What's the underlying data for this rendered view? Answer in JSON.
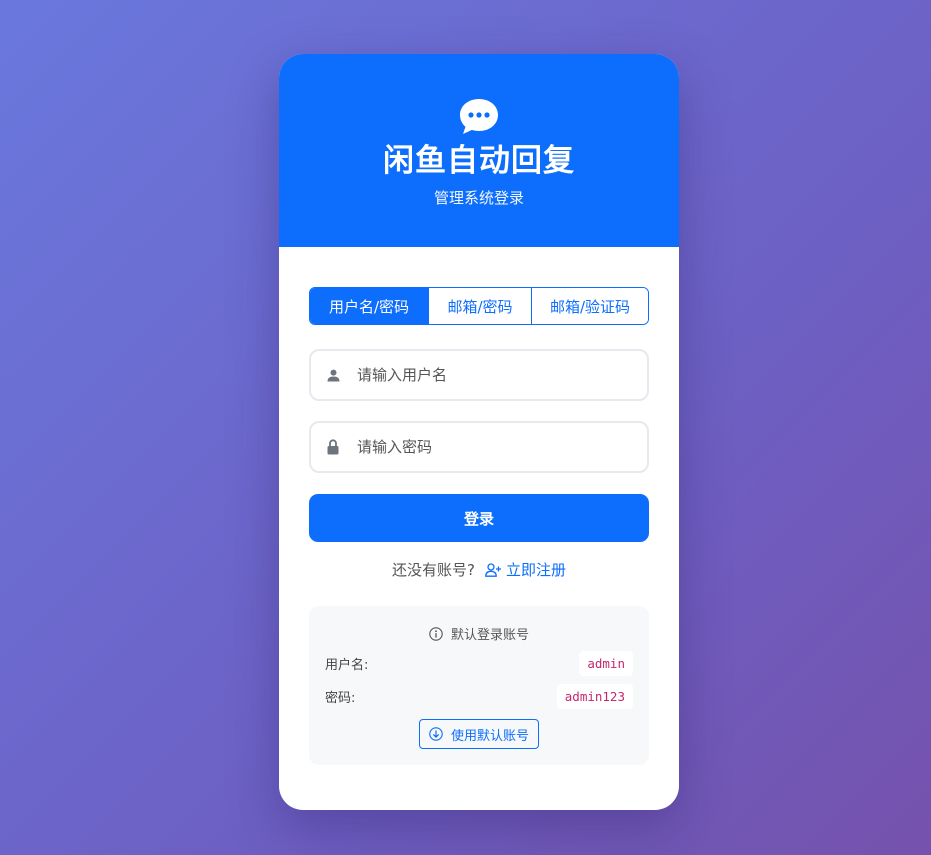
{
  "app": {
    "title": "闲鱼自动回复",
    "subtitle": "管理系统登录",
    "logo_icon": "chat-dots-icon"
  },
  "tabs": [
    {
      "label": "用户名/密码",
      "active": true
    },
    {
      "label": "邮箱/密码",
      "active": false
    },
    {
      "label": "邮箱/验证码",
      "active": false
    }
  ],
  "form": {
    "username": {
      "placeholder": "请输入用户名",
      "value": "",
      "icon": "person-icon"
    },
    "password": {
      "placeholder": "请输入密码",
      "value": "",
      "icon": "lock-icon"
    },
    "login_label": "登录"
  },
  "register": {
    "prompt": "还没有账号?",
    "link_label": "立即注册",
    "icon": "person-plus-icon"
  },
  "default_account": {
    "title": "默认登录账号",
    "username_label": "用户名:",
    "username_value": "admin",
    "password_label": "密码:",
    "password_value": "admin123",
    "use_button_label": "使用默认账号"
  },
  "colors": {
    "primary": "#0d6efd",
    "background_start": "#6a78dd",
    "background_end": "#7552ad",
    "code": "#c5286f"
  }
}
